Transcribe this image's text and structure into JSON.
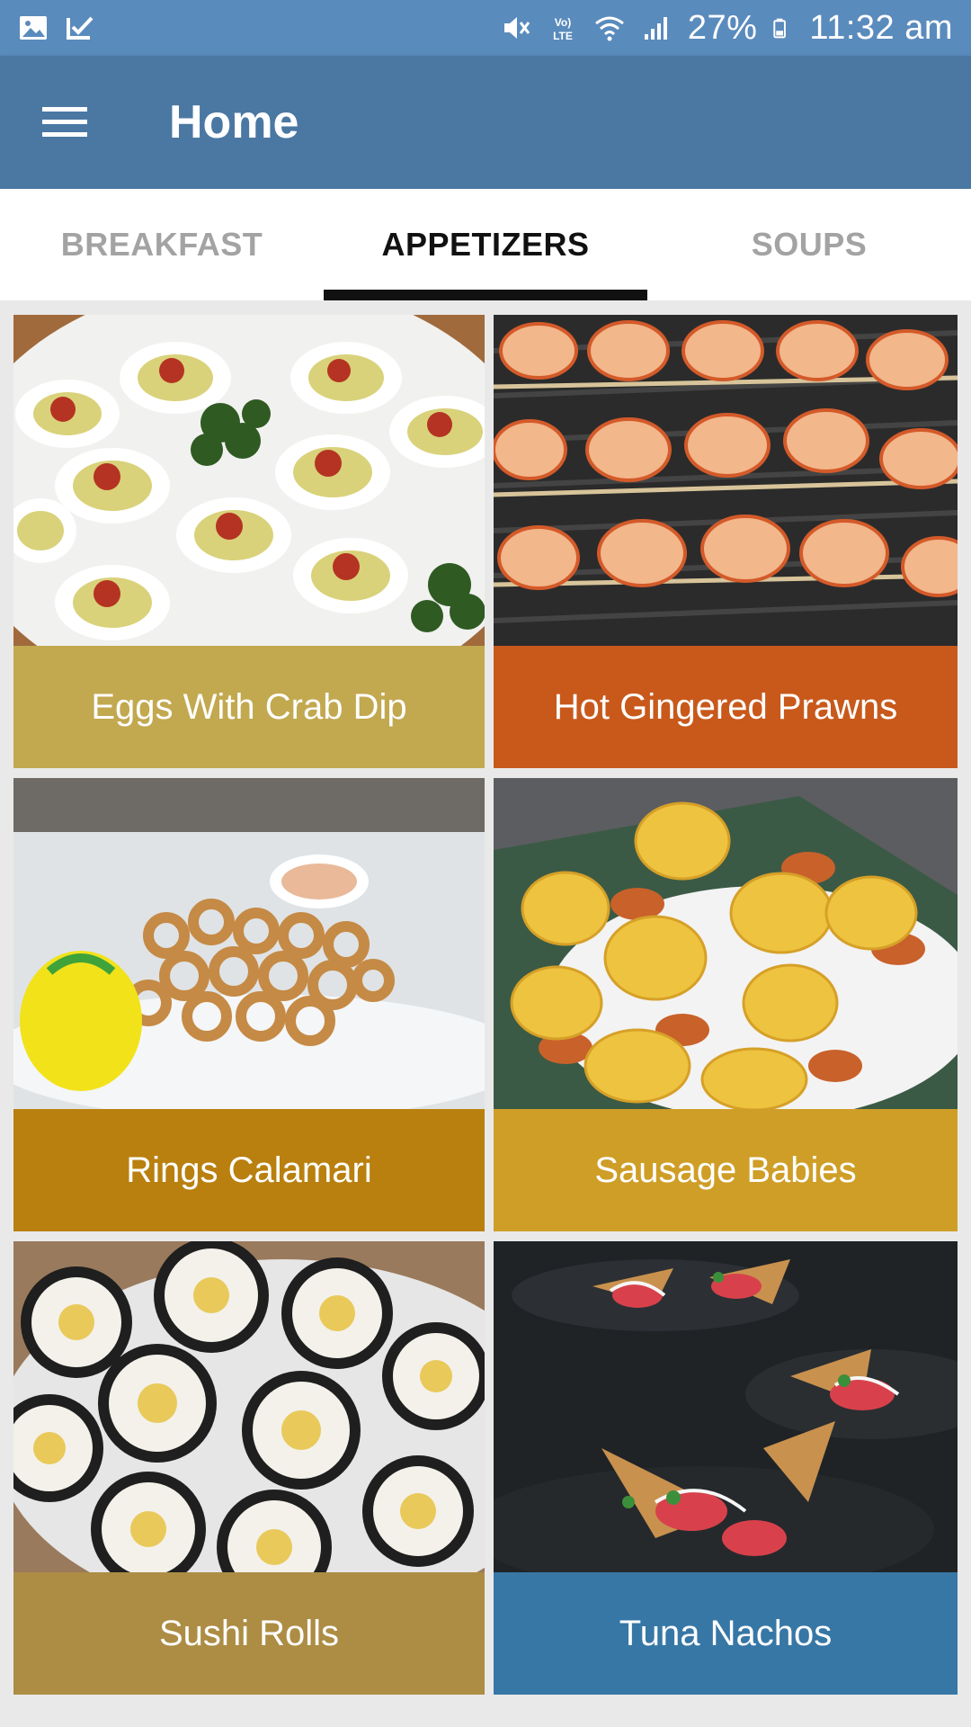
{
  "status_bar": {
    "left_icons": [
      "image-icon",
      "checkbox-icon"
    ],
    "right_icons": [
      "mute-icon",
      "volte-icon",
      "wifi-icon",
      "signal-icon",
      "battery-icon"
    ],
    "battery": "27%",
    "time": "11:32 am"
  },
  "app_bar": {
    "menu_icon": "hamburger-menu-icon",
    "title": "Home",
    "color": "#4a78a3"
  },
  "tabs": [
    {
      "label": "BREAKFAST",
      "active": false
    },
    {
      "label": "APPETIZERS",
      "active": true
    },
    {
      "label": "SOUPS",
      "active": false
    }
  ],
  "recipes": [
    {
      "name": "Eggs With Crab Dip",
      "label_color": "#c2a84f",
      "image": "deviled-eggs-photo"
    },
    {
      "name": "Hot Gingered Prawns",
      "label_color": "#c8591b",
      "image": "grilled-prawns-photo"
    },
    {
      "name": "Rings Calamari",
      "label_color": "#b9800f",
      "image": "fried-calamari-photo"
    },
    {
      "name": "Sausage Babies",
      "label_color": "#cf9e27",
      "image": "sausage-rolls-photo"
    },
    {
      "name": "Sushi Rolls",
      "label_color": "#ad8c44",
      "image": "sushi-rolls-photo"
    },
    {
      "name": "Tuna Nachos",
      "label_color": "#3777a6",
      "image": "tuna-nachos-photo"
    }
  ]
}
